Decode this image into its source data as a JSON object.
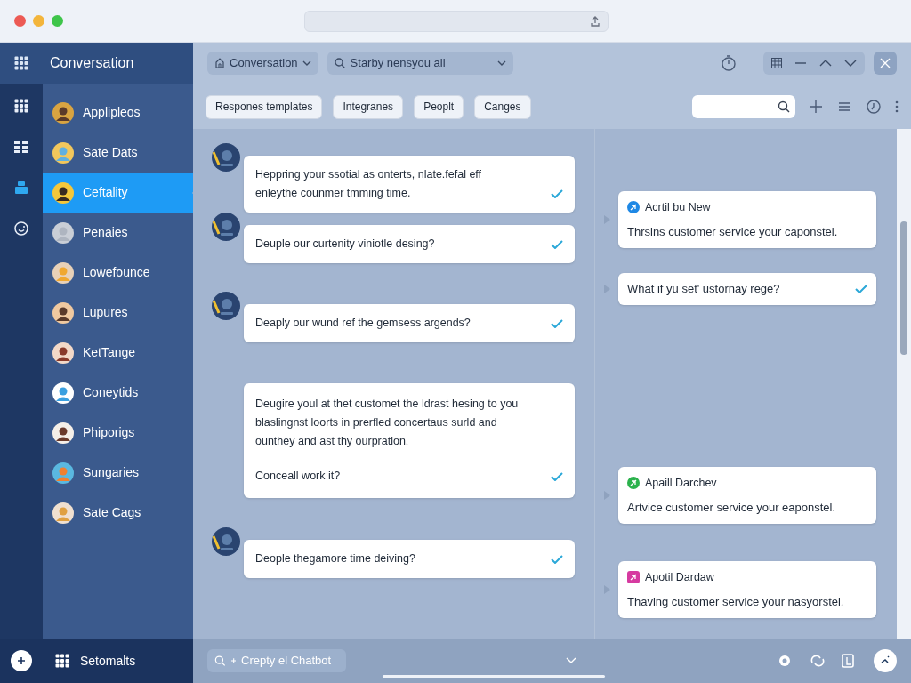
{
  "sidebar": {
    "title": "Conversation",
    "rail": [
      {
        "kind": "grid",
        "selected": false
      },
      {
        "kind": "table",
        "selected": false
      },
      {
        "kind": "team",
        "selected": true
      },
      {
        "kind": "smile",
        "selected": false
      }
    ],
    "items": [
      {
        "label": "Applipleos",
        "selected": false
      },
      {
        "label": "Sate Dats",
        "selected": false
      },
      {
        "label": "Ceftality",
        "selected": true
      },
      {
        "label": "Penaies",
        "selected": false
      },
      {
        "label": "Lowefounce",
        "selected": false
      },
      {
        "label": "Lupures",
        "selected": false
      },
      {
        "label": "KetTange",
        "selected": false
      },
      {
        "label": "Coneytids",
        "selected": false
      },
      {
        "label": "Phiporigs",
        "selected": false
      },
      {
        "label": "Sungaries",
        "selected": false
      },
      {
        "label": "Sate Cags",
        "selected": false
      }
    ],
    "footer": "Setomalts"
  },
  "toolbar": {
    "conversation_menu": "Conversation",
    "search": "Starby nensyou all"
  },
  "chips": [
    "Respones templates",
    "Integranes",
    "Peoplt",
    "Canges"
  ],
  "messages": [
    {
      "avatar": true,
      "text": "Heppring your ssotial as onterts, nlate.fefal eff enleythe counmer tmming time."
    },
    {
      "avatar": true,
      "text": "Deuple our curtenity viniotle desing?"
    },
    {
      "avatar": true,
      "text": "Deaply our wund ref the gemsess argends?"
    },
    {
      "avatar": false,
      "text": "Deugire youl at thet customet the ldrast hesing to you blaslingnst loorts in prerfled concertaus surld and ounthey and ast thy ourpration.",
      "footer": "Conceall work it?"
    },
    {
      "avatar": true,
      "text": "Deople thegamore time deiving?"
    }
  ],
  "replies": [
    {
      "kind": "blue",
      "sender": "Acrtil bu New",
      "text": "Thrsins customer service your caponstel."
    },
    {
      "kind": "plain",
      "text": "What if yu set' ustornay rege?"
    },
    {
      "kind": "green",
      "sender": "Apaill Darchev",
      "text": "Artvice customer service your eaponstel."
    },
    {
      "kind": "pink",
      "sender": "Apotil Dardaw",
      "text": "Thaving customer service your nasyorstel."
    }
  ],
  "composer": {
    "placeholder": "Crepty el Chatbot"
  }
}
